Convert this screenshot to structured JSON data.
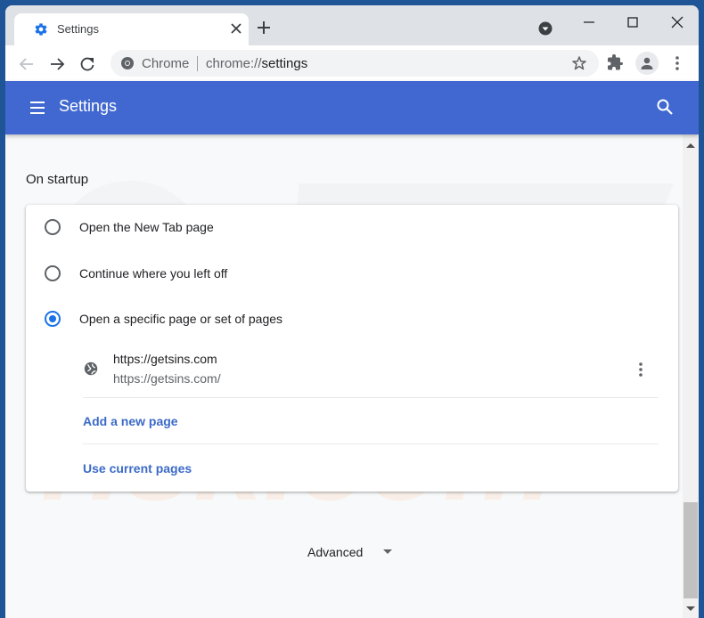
{
  "browser": {
    "tab_title": "Settings",
    "omnibox": {
      "site_label": "Chrome",
      "url_prefix": "chrome://",
      "url_host": "settings"
    }
  },
  "header": {
    "title": "Settings"
  },
  "startup": {
    "section_title": "On startup",
    "options": [
      {
        "label": "Open the New Tab page",
        "checked": false
      },
      {
        "label": "Continue where you left off",
        "checked": false
      },
      {
        "label": "Open a specific page or set of pages",
        "checked": true
      }
    ],
    "pages": [
      {
        "name": "https://getsins.com",
        "url": "https://getsins.com/"
      }
    ],
    "add_page_label": "Add a new page",
    "use_current_label": "Use current pages"
  },
  "advanced_label": "Advanced",
  "colors": {
    "header": "#4068d0",
    "accent": "#1a73e8",
    "link": "#3b6ac8"
  }
}
